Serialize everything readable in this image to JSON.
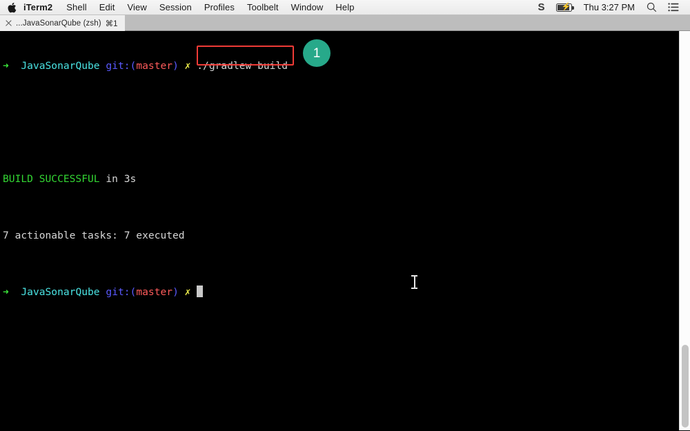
{
  "menubar": {
    "apple_icon": "apple-logo",
    "items": [
      {
        "label": "iTerm2",
        "bold": true
      },
      {
        "label": "Shell"
      },
      {
        "label": "Edit"
      },
      {
        "label": "View"
      },
      {
        "label": "Session"
      },
      {
        "label": "Profiles"
      },
      {
        "label": "Toolbelt"
      },
      {
        "label": "Window"
      },
      {
        "label": "Help"
      }
    ],
    "status": {
      "app_letter": "S",
      "battery_icon": "battery-charging-icon",
      "clock": "Thu 3:27 PM",
      "search_icon": "search-icon",
      "control_center_icon": "control-center-icon"
    }
  },
  "window": {
    "tab": {
      "close_icon": "close-icon",
      "title": "...JavaSonarQube (zsh)",
      "shortcut": "⌘1"
    }
  },
  "terminal": {
    "prompt": {
      "arrow": "➜",
      "dir": "JavaSonarQube",
      "git_open": "git:(",
      "branch": "master",
      "git_close": ")",
      "dirty_mark": "✗"
    },
    "typed_command": "./gradlew build",
    "output_lines": [
      {
        "status": "BUILD SUCCESSFUL",
        "rest": " in 3s"
      },
      {
        "text": "7 actionable tasks: 7 executed"
      }
    ]
  },
  "annotations": {
    "highlight_color": "#ef3b36",
    "badge_number": "1",
    "badge_color": "#27a98a"
  },
  "cursor": {
    "mouse_icon": "text-ibeam-cursor",
    "terminal_caret": "block-caret"
  },
  "scrollbar": {
    "name": "vertical-scrollbar"
  }
}
